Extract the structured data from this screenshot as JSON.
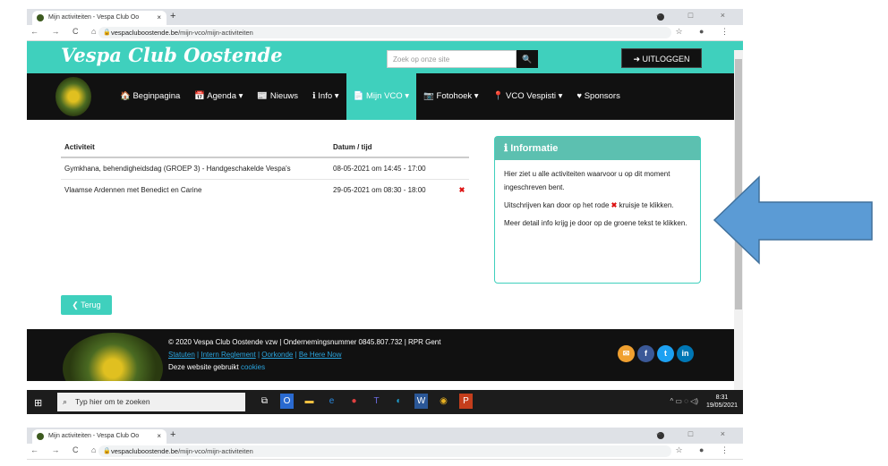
{
  "browser": {
    "tab_title": "Mijn activiteiten - Vespa Club Oo",
    "tab_close": "×",
    "new_tab": "+",
    "window_controls": "− □ ×",
    "nav_buttons": "← → C ⌂",
    "url_host": "vespacluboostende.be",
    "url_path": "/mijn-vco/mijn-activiteiten",
    "right_icons": "☆ ●  ⋮"
  },
  "site": {
    "brand": "Vespa Club Oostende",
    "search_placeholder": "Zoek op onze site",
    "search_button": "🔍",
    "logout": "➜ UITLOGGEN",
    "menu": [
      {
        "label": "🏠 Beginpagina"
      },
      {
        "label": "📅 Agenda ▾"
      },
      {
        "label": "📰 Nieuws"
      },
      {
        "label": "ℹ Info ▾"
      },
      {
        "label": "📄 Mijn VCO ▾"
      },
      {
        "label": "📷 Fotohoek ▾"
      },
      {
        "label": "📍 VCO Vespisti ▾"
      },
      {
        "label": "♥ Sponsors"
      }
    ],
    "table": {
      "headers": [
        "Activiteit",
        "Datum / tijd"
      ],
      "rows": [
        {
          "activity": "Gymkhana, behendigheidsdag (GROEP 3) - Handgeschakelde Vespa's",
          "date": "08-05-2021 om 14:45 - 17:00",
          "remove": ""
        },
        {
          "activity": "Vlaamse Ardennen met Benedict en Carine",
          "date": "29-05-2021 om 08:30 - 18:00",
          "remove": "✖"
        }
      ]
    },
    "info": {
      "title": "ℹ Informatie",
      "p1": "Hier ziet u alle activiteiten waarvoor u op dit moment ingeschreven bent.",
      "p2_before": "Uitschrijven kan door op het rode",
      "p2_x": "✖",
      "p2_after": "kruisje te klikken.",
      "p3": "Meer detail info krijg je door op de groene tekst te klikken."
    },
    "back_button": "❮ Terug",
    "footer": {
      "line1": "© 2020 Vespa Club Oostende vzw | Ondernemingsnummer 0845.807.732 | RPR Gent",
      "links": [
        "Statuten",
        "Intern Reglement",
        "Oorkonde",
        "Be Here Now"
      ],
      "cookie_text": "Deze website gebruikt",
      "cookie_link": "cookies",
      "social": [
        "✉",
        "f",
        "t",
        "in"
      ]
    }
  },
  "taskbar": {
    "search_placeholder": "Typ hier om te zoeken",
    "time": "8:31",
    "date": "19/05/2021",
    "tray": "^ ▭ ◌ ◁)"
  },
  "colors": {
    "accent": "#3fd0bd",
    "arrow": "#5b9bd5"
  }
}
